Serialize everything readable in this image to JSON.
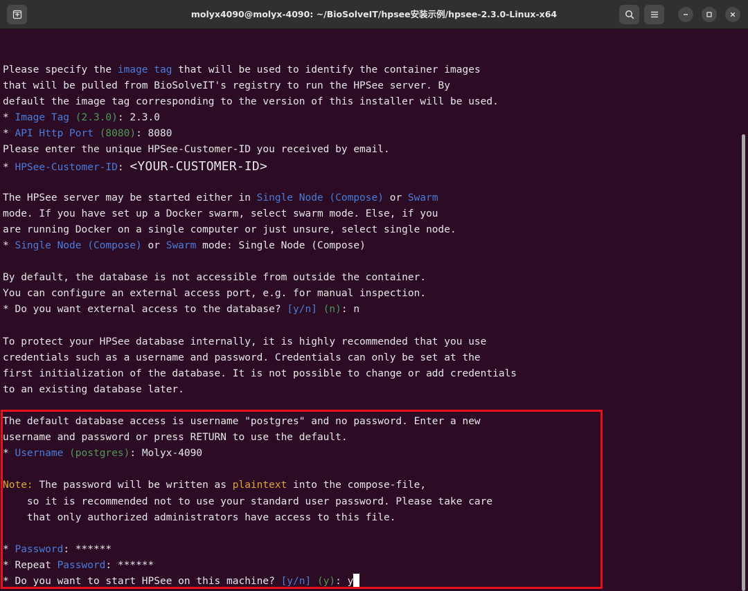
{
  "window": {
    "title": "molyx4090@molyx-4090: ~/BioSolveIT/hpsee安装示例/hpsee-2.3.0-Linux-x64",
    "buttons": {
      "new_tab_icon": "new-tab-icon",
      "search_icon": "search-icon",
      "menu_icon": "hamburger-menu-icon",
      "minimize_icon": "minimize-icon",
      "maximize_icon": "maximize-icon",
      "close_icon": "close-icon"
    }
  },
  "colors": {
    "background": "#2c0c24",
    "text": "#e6e6e6",
    "keyword_blue": "#4b7bd9",
    "default_green": "#4d9a56",
    "note_orange": "#e0a52c",
    "highlight_red": "#e8121a"
  },
  "terminal": {
    "lines": [
      [
        {
          "t": "Please specify the "
        },
        {
          "t": "image tag",
          "c": "blue"
        },
        {
          "t": " that will be used to identify the container images"
        }
      ],
      [
        {
          "t": "that will be pulled from BioSolveIT's registry to run the HPSee server. By"
        }
      ],
      [
        {
          "t": "default the image tag corresponding to the version of this installer will be used."
        }
      ],
      [
        {
          "t": "* "
        },
        {
          "t": "Image Tag",
          "c": "blue"
        },
        {
          "t": " "
        },
        {
          "t": "(2.3.0)",
          "c": "green"
        },
        {
          "t": ": 2.3.0"
        }
      ],
      [
        {
          "t": "* "
        },
        {
          "t": "API Http Port",
          "c": "blue"
        },
        {
          "t": " "
        },
        {
          "t": "(8080)",
          "c": "green"
        },
        {
          "t": ": 8080"
        }
      ],
      [
        {
          "t": "Please enter the unique HPSee-Customer-ID you received by email."
        }
      ],
      [
        {
          "t": "* "
        },
        {
          "t": "HPSee-Customer-ID",
          "c": "blue"
        },
        {
          "t": ": "
        },
        {
          "t": "<YOUR-CUSTOMER-ID>",
          "c": "big"
        }
      ],
      [],
      [
        {
          "t": "The HPSee server may be started either in "
        },
        {
          "t": "Single Node (Compose)",
          "c": "blue"
        },
        {
          "t": " or "
        },
        {
          "t": "Swarm",
          "c": "blue"
        }
      ],
      [
        {
          "t": "mode. If you have set up a Docker swarm, select swarm mode. Else, if you"
        }
      ],
      [
        {
          "t": "are running Docker on a single computer or just unsure, select single node."
        }
      ],
      [
        {
          "t": "* "
        },
        {
          "t": "Single Node (Compose)",
          "c": "blue"
        },
        {
          "t": " or "
        },
        {
          "t": "Swarm",
          "c": "blue"
        },
        {
          "t": " mode: Single Node (Compose)"
        }
      ],
      [],
      [
        {
          "t": "By default, the database is not accessible from outside the container."
        }
      ],
      [
        {
          "t": "You can configure an external access port, e.g. for manual inspection."
        }
      ],
      [
        {
          "t": "* Do you want external access to the database? "
        },
        {
          "t": "[y/n]",
          "c": "blue"
        },
        {
          "t": " "
        },
        {
          "t": "(n)",
          "c": "green"
        },
        {
          "t": ": n"
        }
      ],
      [],
      [
        {
          "t": "To protect your HPSee database internally, it is highly recommended that you use"
        }
      ],
      [
        {
          "t": "credentials such as a username and password. Credentials can only be set at the"
        }
      ],
      [
        {
          "t": "first initialization of the database. It is not possible to change or add credentials"
        }
      ],
      [
        {
          "t": "to an existing database later."
        }
      ],
      [],
      [
        {
          "t": "The default database access is username \"postgres\" and no password. Enter a new"
        }
      ],
      [
        {
          "t": "username and password or press RETURN to use the default."
        }
      ],
      [
        {
          "t": "* "
        },
        {
          "t": "Username",
          "c": "blue"
        },
        {
          "t": " "
        },
        {
          "t": "(postgres)",
          "c": "green"
        },
        {
          "t": ": Molyx-4090"
        }
      ],
      [],
      [
        {
          "t": "Note:",
          "c": "orange"
        },
        {
          "t": " The password will be written as "
        },
        {
          "t": "plaintext",
          "c": "orange"
        },
        {
          "t": " into the compose-file,"
        }
      ],
      [
        {
          "t": "    so it is recommended not to use your standard user password. Please take care"
        }
      ],
      [
        {
          "t": "    that only authorized administrators have access to this file."
        }
      ],
      [],
      [
        {
          "t": "* "
        },
        {
          "t": "Password",
          "c": "blue"
        },
        {
          "t": ": ******"
        }
      ],
      [
        {
          "t": "* Repeat "
        },
        {
          "t": "Password",
          "c": "blue"
        },
        {
          "t": ": ******"
        }
      ],
      [
        {
          "t": "* Do you want to start HPSee on this machine? "
        },
        {
          "t": "[y/n]",
          "c": "blue"
        },
        {
          "t": " "
        },
        {
          "t": "(y)",
          "c": "green"
        },
        {
          "t": ": y"
        },
        {
          "cursor": true
        }
      ]
    ]
  }
}
